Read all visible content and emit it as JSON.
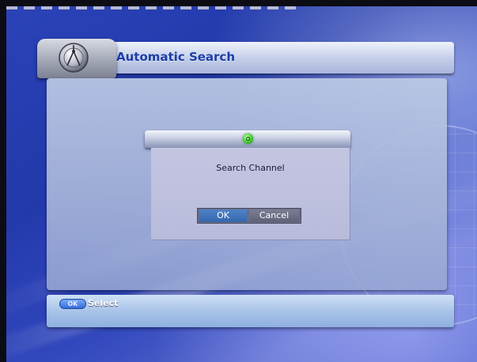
{
  "header": {
    "title": "Automatic Search"
  },
  "dialog": {
    "message": "Search Channel",
    "ok_label": "OK",
    "cancel_label": "Cancel",
    "focused_button": "OK"
  },
  "footer": {
    "ok_key_label": "OK",
    "hint_label": "Select"
  },
  "icons": {
    "header_logo": "satellite-dish-icon",
    "dialog_status": "green-status-icon",
    "footer_key": "ok-key-icon"
  },
  "colors": {
    "title_text": "#1d3ea6",
    "ok_button_focused": "#3566ad",
    "cancel_button": "#5f6276",
    "status_icon": "#4fd33a"
  }
}
